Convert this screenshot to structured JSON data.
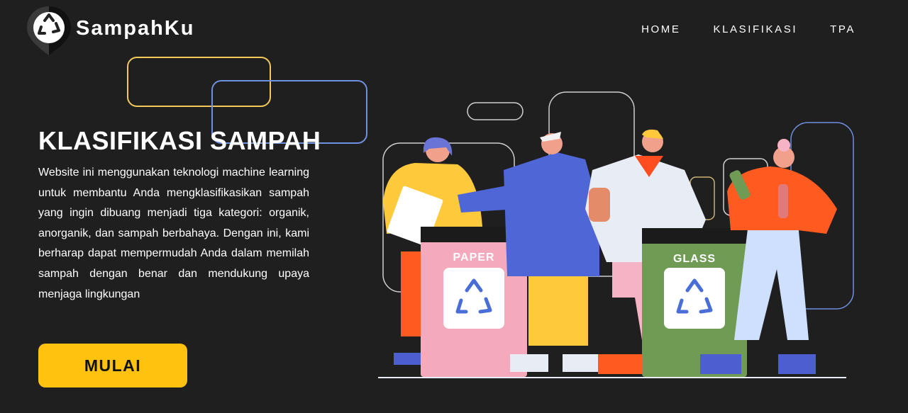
{
  "brand": {
    "name": "SampahKu",
    "logo_icon": "recycle-icon"
  },
  "nav": {
    "items": [
      {
        "label": "HOME"
      },
      {
        "label": "KLASIFIKASI"
      },
      {
        "label": "TPA"
      }
    ]
  },
  "hero": {
    "title": "KLASIFIKASI SAMPAH",
    "description": "Website ini menggunakan teknologi machine learning untuk membantu Anda mengklasifikasikan sampah yang ingin dibuang menjadi tiga kategori: organik, anorganik, dan sampah berbahaya. Dengan ini, kami berharap dapat mempermudah Anda dalam memilah sampah dengan benar dan mendukung upaya menjaga lingkungan",
    "cta_label": "MULAI"
  },
  "illustration": {
    "bin_left_label": "PAPER",
    "bin_right_label": "GLASS"
  },
  "colors": {
    "background": "#1f1f1f",
    "accent": "#ffc20e",
    "bin_paper": "#f4a9bd",
    "bin_glass": "#6f9b55"
  }
}
